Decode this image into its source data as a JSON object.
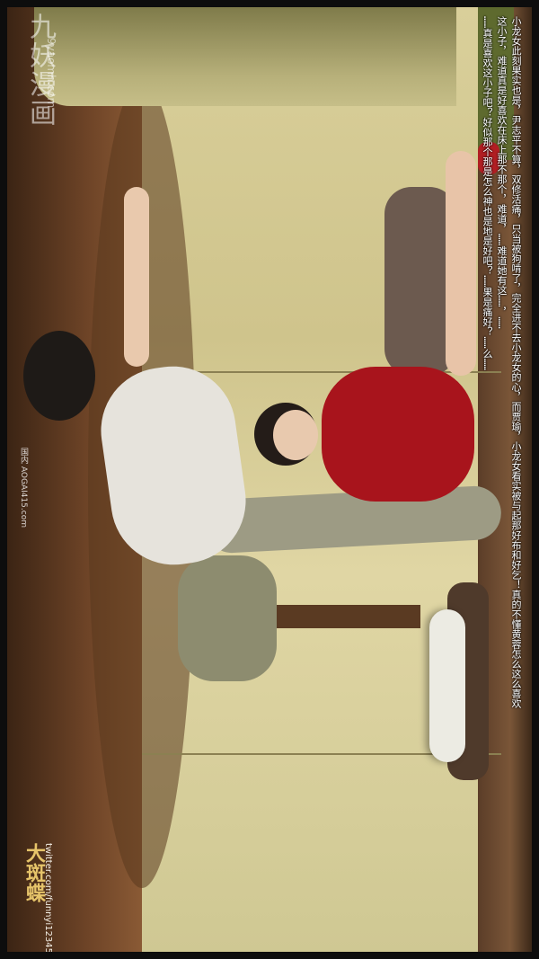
{
  "watermark": {
    "site_name": "九妖漫画",
    "url": "9yaomh.com"
  },
  "credits": {
    "small_text": "国内 AOGAI415.com",
    "brand": "大斑蝶",
    "twitter": "twitter.com/funnyi1234567"
  },
  "caption": {
    "lines": [
      "小龙女此刻果实也是，尹志平不算，双修活痛，只当被狗啃了，完全进不去小龙女的心，而贾瑜，小龙女看实被与起那好布和好乞！真的不懂黄蓉怎么这么喜欢",
      "这小子，难道真是好喜欢在床上那不那个，难道，……难道她有这……，……",
      "……真是喜欢这小子吧？好似那个那是怎么神也是地是好吧？……果是痛好？……么……"
    ]
  }
}
